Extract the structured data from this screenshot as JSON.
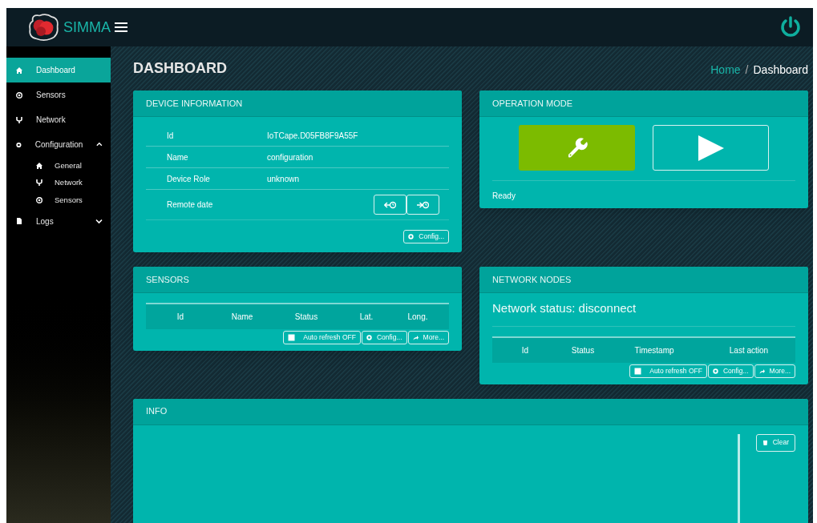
{
  "brand": "SIMMA",
  "sidebar": {
    "items": [
      {
        "label": "Dashboard",
        "selected": true
      },
      {
        "label": "Sensors",
        "selected": false
      },
      {
        "label": "Network",
        "selected": false
      },
      {
        "label": "Configuration",
        "selected": false,
        "expanded": true,
        "children": [
          {
            "label": "General",
            "selected": false
          },
          {
            "label": "Network",
            "selected": false
          },
          {
            "label": "Sensors",
            "selected": false
          }
        ]
      },
      {
        "label": "Logs",
        "selected": false,
        "expanded": false
      }
    ]
  },
  "page_title": "DASHBOARD",
  "breadcrumb": [
    "Home",
    "/",
    "Dashboard"
  ],
  "device_information": {
    "title": "DEVICE INFORMATION",
    "rows": [
      {
        "label": "Id",
        "value": "IoTCape.D05FB8F9A55F"
      },
      {
        "label": "Name",
        "value": "configuration"
      },
      {
        "label": "Device Role",
        "value": "unknown"
      },
      {
        "label": "Remote date"
      }
    ],
    "config_button": "Config..."
  },
  "operation_mode": {
    "title": "OPERATION MODE",
    "modes": [
      {
        "selected": true
      },
      {
        "selected": false
      }
    ],
    "status": "Ready"
  },
  "sensors": {
    "title": "SENSORS",
    "columns": [
      "Id",
      "Name",
      "Status",
      "Lat.",
      "Long."
    ],
    "auto_refresh": {
      "label": "Auto refresh OFF",
      "checked": false
    },
    "config_button": "Config...",
    "more_button": "More..."
  },
  "network_nodes": {
    "title": "NETWORK NODES",
    "status": "Network status: disconnect",
    "columns": [
      "Id",
      "Status",
      "Timestamp",
      "Last action"
    ],
    "auto_refresh": {
      "label": "Auto refresh OFF",
      "checked": false
    },
    "config_button": "Config...",
    "more_button": "More..."
  },
  "info": {
    "title": "INFO",
    "clear_button": "Clear"
  }
}
